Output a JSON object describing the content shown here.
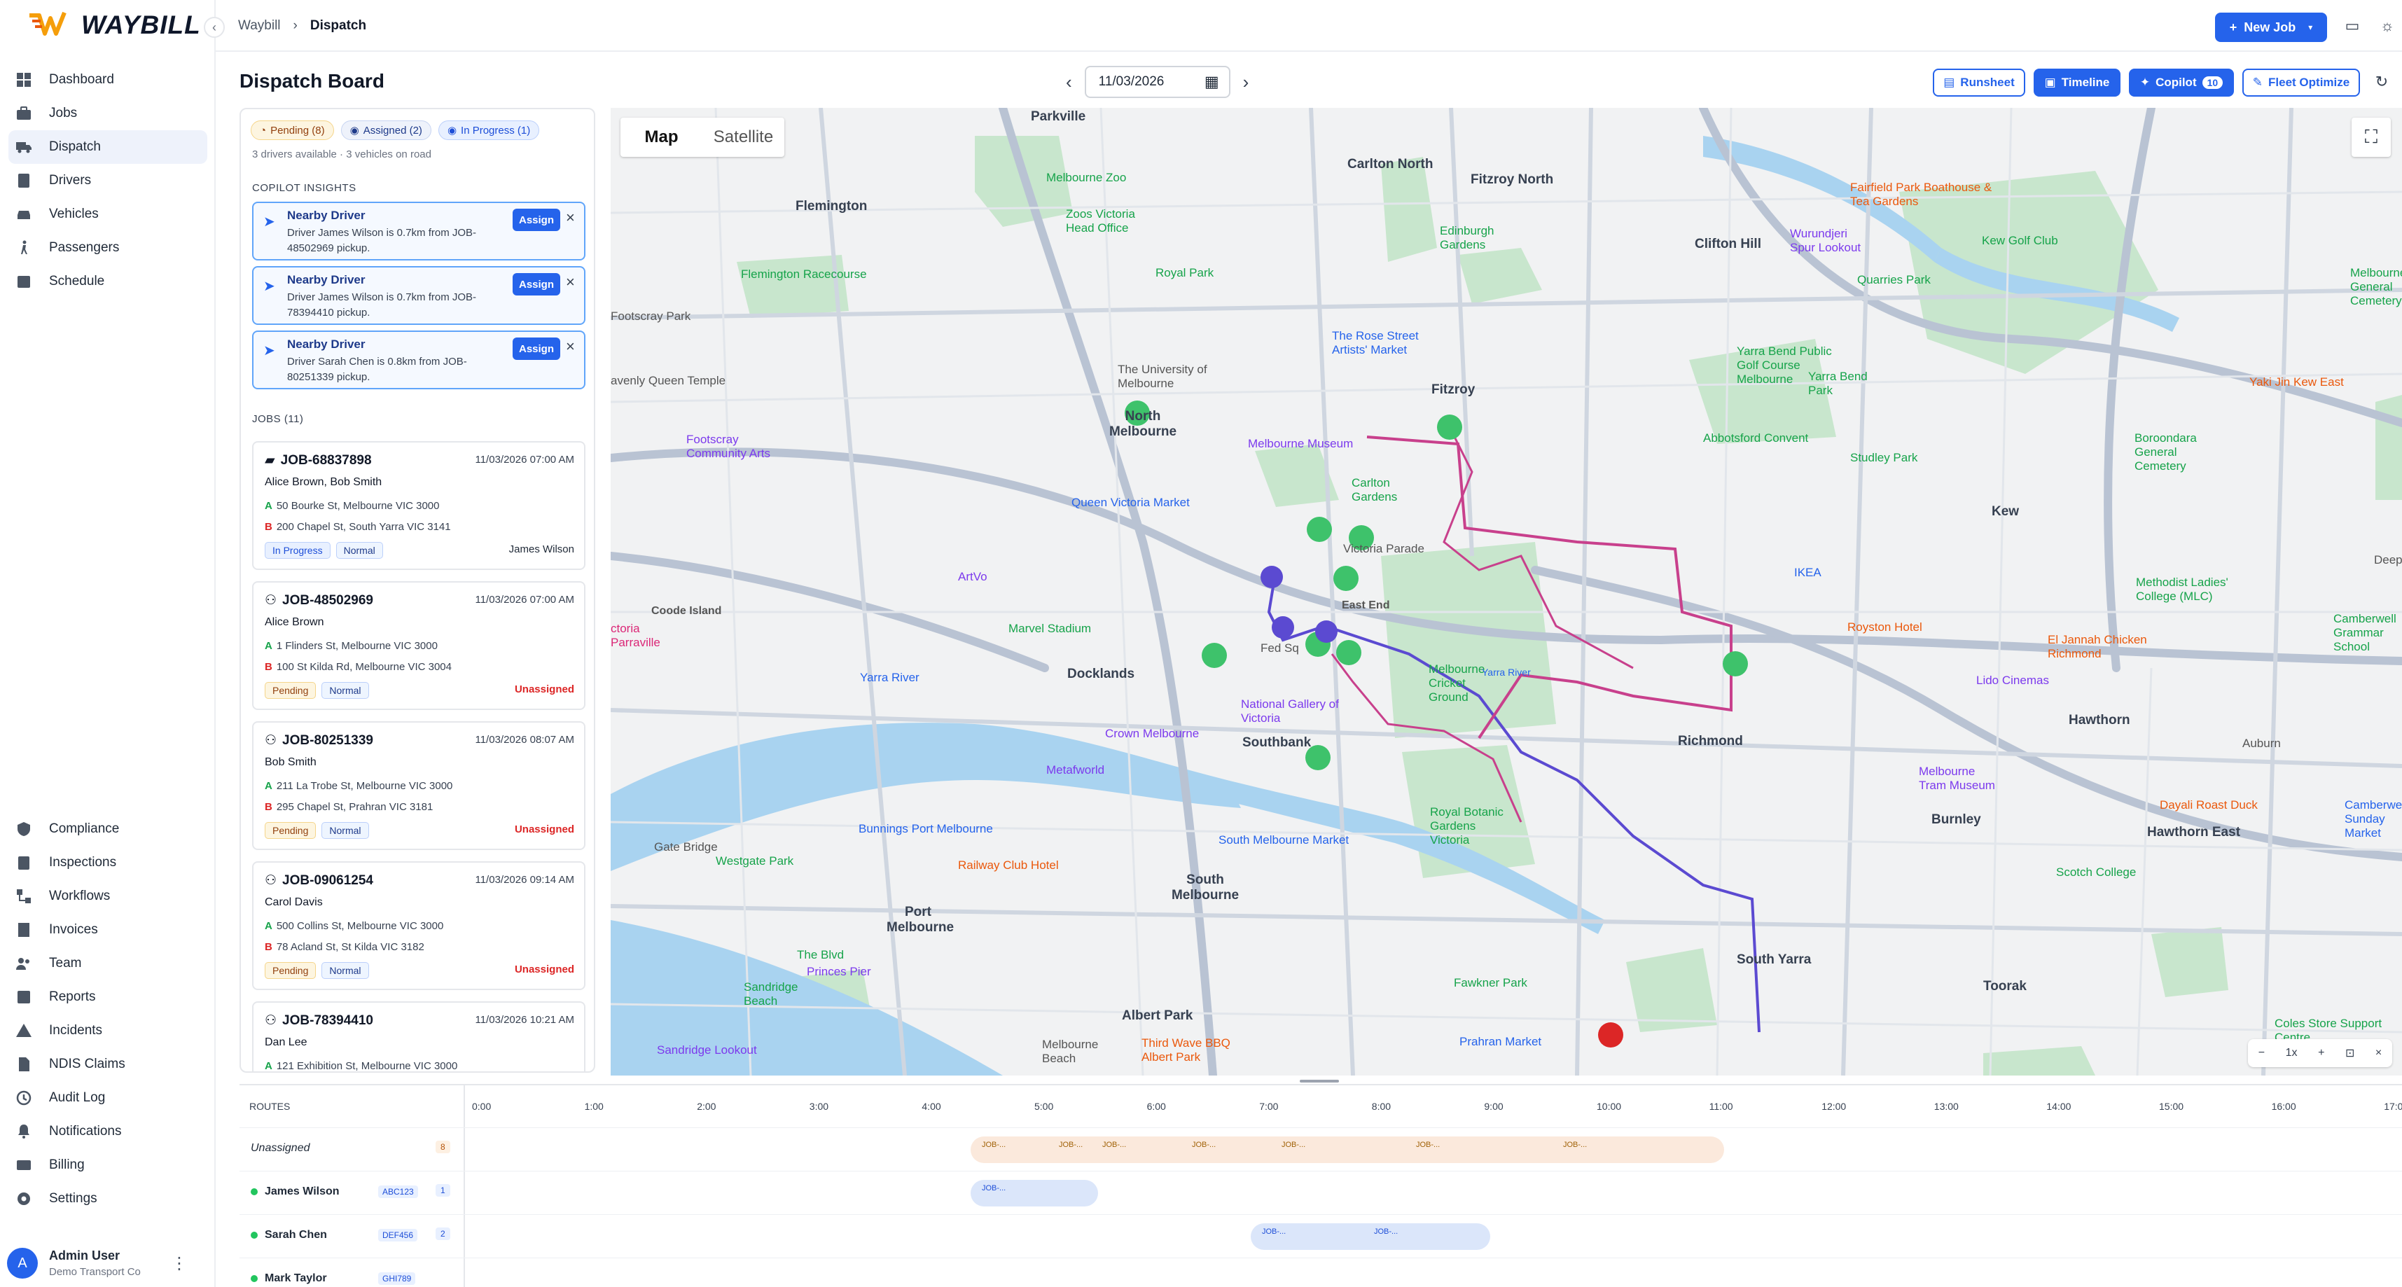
{
  "brand": {
    "name": "WAYBILL"
  },
  "topbar": {
    "breadcrumb": [
      "Waybill",
      "Dispatch"
    ],
    "new_job": "New Job"
  },
  "sidebar": {
    "items": [
      {
        "label": "Dashboard",
        "icon": "grid-icon"
      },
      {
        "label": "Jobs",
        "icon": "briefcase-icon"
      },
      {
        "label": "Dispatch",
        "icon": "truck-icon",
        "active": true
      },
      {
        "label": "Drivers",
        "icon": "id-badge-icon"
      },
      {
        "label": "Vehicles",
        "icon": "car-icon"
      },
      {
        "label": "Passengers",
        "icon": "person-walking-icon"
      },
      {
        "label": "Schedule",
        "icon": "calendar-icon"
      }
    ],
    "bottom_items": [
      {
        "label": "Compliance",
        "icon": "shield-icon"
      },
      {
        "label": "Inspections",
        "icon": "clipboard-icon"
      },
      {
        "label": "Workflows",
        "icon": "workflow-icon"
      },
      {
        "label": "Invoices",
        "icon": "invoice-icon"
      },
      {
        "label": "Team",
        "icon": "team-icon"
      },
      {
        "label": "Reports",
        "icon": "chart-icon"
      },
      {
        "label": "Incidents",
        "icon": "warning-icon"
      },
      {
        "label": "NDIS Claims",
        "icon": "document-icon"
      },
      {
        "label": "Audit Log",
        "icon": "history-icon"
      },
      {
        "label": "Notifications",
        "icon": "bell-icon"
      },
      {
        "label": "Billing",
        "icon": "card-icon"
      },
      {
        "label": "Settings",
        "icon": "gear-icon"
      }
    ],
    "user": {
      "initial": "A",
      "name": "Admin User",
      "org": "Demo Transport Co"
    }
  },
  "header": {
    "title": "Dispatch Board",
    "date": "11/03/2026",
    "buttons": {
      "runsheet": "Runsheet",
      "timeline": "Timeline",
      "copilot": "Copilot",
      "copilot_count": "10",
      "fleet_optimize": "Fleet Optimize"
    }
  },
  "panel": {
    "chips": {
      "pending": "Pending (8)",
      "assigned": "Assigned (2)",
      "in_progress": "In Progress (1)"
    },
    "availability": "3 drivers available · 3 vehicles on road",
    "insights_title": "COPILOT INSIGHTS",
    "insights": [
      {
        "title": "Nearby Driver",
        "desc": "Driver James Wilson is 0.7km from JOB-48502969 pickup.",
        "action": "Assign"
      },
      {
        "title": "Nearby Driver",
        "desc": "Driver James Wilson is 0.7km from JOB-78394410 pickup.",
        "action": "Assign"
      },
      {
        "title": "Nearby Driver",
        "desc": "Driver Sarah Chen is 0.8km from JOB-80251339 pickup.",
        "action": "Assign"
      }
    ],
    "jobs_title": "JOBS (11)",
    "jobs": [
      {
        "id": "JOB-68837898",
        "datetime": "11/03/2026 07:00 AM",
        "passengers": "Alice Brown, Bob Smith",
        "a": "50 Bourke St, Melbourne VIC 3000",
        "b": "200 Chapel St, South Yarra VIC 3141",
        "status": "In Progress",
        "priority": "Normal",
        "driver": "James Wilson"
      },
      {
        "id": "JOB-48502969",
        "datetime": "11/03/2026 07:00 AM",
        "passengers": "Alice Brown",
        "a": "1 Flinders St, Melbourne VIC 3000",
        "b": "100 St Kilda Rd, Melbourne VIC 3004",
        "status": "Pending",
        "priority": "Normal",
        "driver": "Unassigned"
      },
      {
        "id": "JOB-80251339",
        "datetime": "11/03/2026 08:07 AM",
        "passengers": "Bob Smith",
        "a": "211 La Trobe St, Melbourne VIC 3000",
        "b": "295 Chapel St, Prahran VIC 3181",
        "status": "Pending",
        "priority": "Normal",
        "driver": "Unassigned"
      },
      {
        "id": "JOB-09061254",
        "datetime": "11/03/2026 09:14 AM",
        "passengers": "Carol Davis",
        "a": "500 Collins St, Melbourne VIC 3000",
        "b": "78 Acland St, St Kilda VIC 3182",
        "status": "Pending",
        "priority": "Normal",
        "driver": "Unassigned"
      },
      {
        "id": "JOB-78394410",
        "datetime": "11/03/2026 10:21 AM",
        "passengers": "Dan Lee",
        "a": "121 Exhibition St, Melbourne VIC 3000",
        "b": "",
        "status": "",
        "priority": "",
        "driver": ""
      }
    ]
  },
  "map": {
    "toggle": {
      "map": "Map",
      "satellite": "Satellite"
    },
    "zoom_label": "1x",
    "places": [
      "Parkville",
      "Carlton North",
      "Fitzroy North",
      "Flemington",
      "Clifton Hill",
      "North Melbourne",
      "Fitzroy",
      "Kew",
      "Coode Island",
      "East End",
      "Docklands",
      "Southbank",
      "Richmond",
      "Hawthorn",
      "Burnley",
      "Hawthorn East",
      "Toorak",
      "South Yarra",
      "South Melbourne",
      "Port Melbourne",
      "Albert Park"
    ],
    "pois": [
      {
        "label": "Melbourne Zoo",
        "c": "g"
      },
      {
        "label": "Royal Park",
        "c": "g"
      },
      {
        "label": "Flemington Racecourse",
        "c": "g"
      },
      {
        "label": "Footscray Park",
        "c": "g"
      },
      {
        "label": "Melbourne Museum",
        "c": "p"
      },
      {
        "label": "Queen Victoria Market",
        "c": "b"
      },
      {
        "label": "Carlton Gardens",
        "c": "g"
      },
      {
        "label": "The Rose Street Artists' Market",
        "c": "b"
      },
      {
        "label": "Fairfield Park Boathouse & Tea Gardens",
        "c": "o"
      },
      {
        "label": "Wurundjeri Spur Lookout",
        "c": "p"
      },
      {
        "label": "Yarra Bend Park",
        "c": "g"
      },
      {
        "label": "Kew Golf Club",
        "c": "g"
      },
      {
        "label": "Abbotsford Convent",
        "c": "g"
      },
      {
        "label": "Studley Park",
        "c": "g"
      },
      {
        "label": "Yaki Jin Kew East",
        "c": "o"
      },
      {
        "label": "Footscray Community Arts",
        "c": "p"
      },
      {
        "label": "ArtVo",
        "c": "p"
      },
      {
        "label": "Marvel Stadium",
        "c": "g"
      },
      {
        "label": "Crown Melbourne",
        "c": "p"
      },
      {
        "label": "National Gallery of Victoria",
        "c": "p"
      },
      {
        "label": "Melbourne Cricket Ground",
        "c": "g"
      },
      {
        "label": "IKEA",
        "c": "b"
      },
      {
        "label": "Royston Hotel",
        "c": "o"
      },
      {
        "label": "El Jannah Chicken Richmond",
        "c": "o"
      },
      {
        "label": "Lido Cinemas",
        "c": "p"
      },
      {
        "label": "Methodist Ladies' College (MLC)",
        "c": "g"
      },
      {
        "label": "Royal Botanic Gardens Victoria",
        "c": "g"
      },
      {
        "label": "Melbourne Tram Museum",
        "c": "p"
      },
      {
        "label": "Metafworld",
        "c": "p"
      },
      {
        "label": "Bunnings Port Melbourne",
        "c": "b"
      },
      {
        "label": "South Melbourne Market",
        "c": "b"
      },
      {
        "label": "Railway Club Hotel",
        "c": "o"
      },
      {
        "label": "Scotch College",
        "c": "g"
      },
      {
        "label": "Dayali Roast Duck",
        "c": "o"
      },
      {
        "label": "Camberwell Sunday Market",
        "c": "b"
      },
      {
        "label": "Sandridge Beach",
        "c": "g"
      },
      {
        "label": "The Blvd",
        "c": "g"
      },
      {
        "label": "Princes Pier",
        "c": "p"
      },
      {
        "label": "Fawkner Park",
        "c": "g"
      },
      {
        "label": "Prahran Market",
        "c": "b"
      },
      {
        "label": "Coles Store Support Centre",
        "c": "g"
      },
      {
        "label": "Sandridge Lookout",
        "c": "p"
      },
      {
        "label": "Third Wave BBQ Albert Park",
        "c": "o"
      },
      {
        "label": "Melbourne Beach",
        "c": "g"
      },
      {
        "label": "Yarra River",
        "c": "b"
      },
      {
        "label": "Westgate Park",
        "c": "g"
      },
      {
        "label": "Gate Bridge",
        "c": "g"
      },
      {
        "label": "Deep",
        "c": "g"
      },
      {
        "label": "Fed Sq",
        "c": "g"
      },
      {
        "label": "Yarra Bend Public Golf Course Melbourne",
        "c": "g"
      },
      {
        "label": "Quarries Park",
        "c": "g"
      },
      {
        "label": "Boroondara General Cemetery",
        "c": "g"
      },
      {
        "label": "Camberwell Grammar School",
        "c": "g"
      },
      {
        "label": "Melbourne General Cemetery",
        "c": "g"
      },
      {
        "label": "The University of Melbourne",
        "c": "g"
      },
      {
        "label": "Edinburgh Gardens",
        "c": "g"
      },
      {
        "label": "Victoria Parade",
        "c": "g"
      },
      {
        "label": "ctoria Parraville",
        "c": "r"
      },
      {
        "label": "avenly Queen Temple",
        "c": "g"
      },
      {
        "label": "Zoos Victoria Head Office",
        "c": "g"
      },
      {
        "label": "Auburn",
        "c": "g"
      },
      {
        "label": "Yarra River",
        "c": "b"
      }
    ]
  },
  "timeline": {
    "title": "ROUTES",
    "hours": [
      "0:00",
      "1:00",
      "2:00",
      "3:00",
      "4:00",
      "5:00",
      "6:00",
      "7:00",
      "8:00",
      "9:00",
      "10:00",
      "11:00",
      "12:00",
      "13:00",
      "14:00",
      "15:00",
      "16:00",
      "17:0"
    ],
    "rows": [
      {
        "name": "Unassigned",
        "vehicle": "",
        "count": "8"
      },
      {
        "name": "James Wilson",
        "vehicle": "ABC123",
        "count": "1"
      },
      {
        "name": "Sarah Chen",
        "vehicle": "DEF456",
        "count": "2"
      },
      {
        "name": "Mark Taylor",
        "vehicle": "GHI789",
        "count": ""
      }
    ],
    "job_mark_label": "JOB-..."
  },
  "colors": {
    "accent": "#2563eb",
    "pending": "#f5d58a",
    "unassigned": "#dc2626",
    "route_purple": "#5b4ad1",
    "route_pink": "#c8408c",
    "marker_green": "#3ec26b"
  }
}
